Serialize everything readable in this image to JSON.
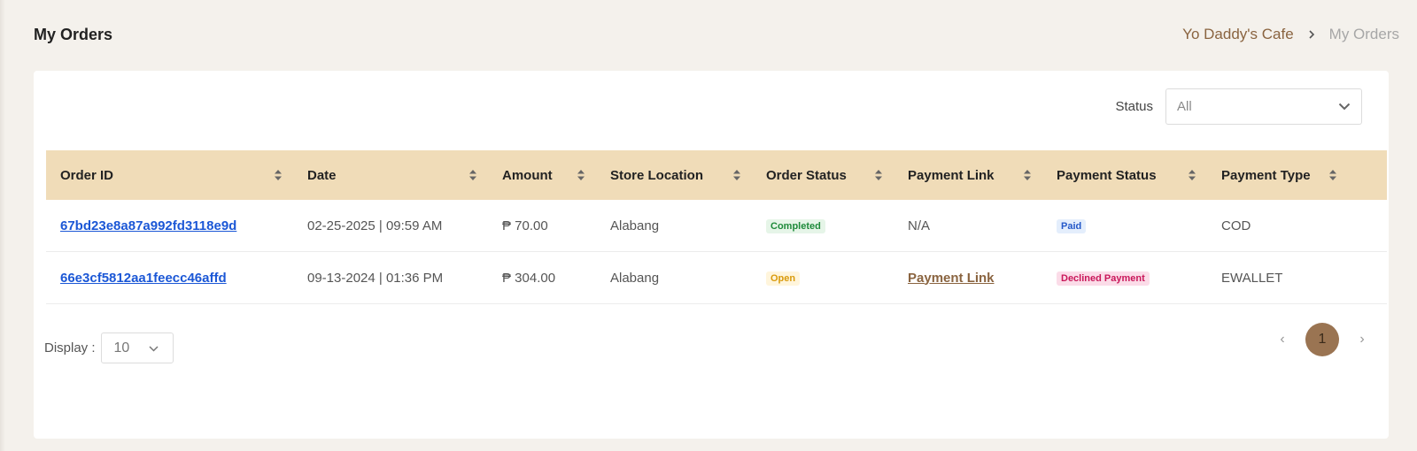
{
  "header": {
    "title": "My Orders",
    "breadcrumb": [
      "Yo Daddy's Cafe",
      "My Orders"
    ]
  },
  "filter": {
    "label": "Status",
    "value": "All"
  },
  "table": {
    "columns": [
      "Order ID",
      "Date",
      "Amount",
      "Store Location",
      "Order Status",
      "Payment Link",
      "Payment Status",
      "Payment Type"
    ],
    "rows": [
      {
        "order_id": "67bd23e8a87a992fd3118e9d",
        "date": "02-25-2025 | 09:59 AM",
        "amount": "₱ 70.00",
        "store_location": "Alabang",
        "order_status": "Completed",
        "payment_link": "N/A",
        "payment_status": "Paid",
        "payment_type": "COD"
      },
      {
        "order_id": "66e3cf5812aa1feecc46affd",
        "date": "09-13-2024 | 01:36 PM",
        "amount": "₱ 304.00",
        "store_location": "Alabang",
        "order_status": "Open",
        "payment_link": "Payment Link",
        "payment_status": "Declined Payment",
        "payment_type": "EWALLET"
      }
    ]
  },
  "display": {
    "label": "Display :",
    "value": "10"
  },
  "pagination": {
    "prev": "‹",
    "current": "1",
    "next": "›"
  },
  "colors": {
    "accent": "#9a7452",
    "header_bg": "#f0dcb8",
    "link": "#1b57d6"
  }
}
